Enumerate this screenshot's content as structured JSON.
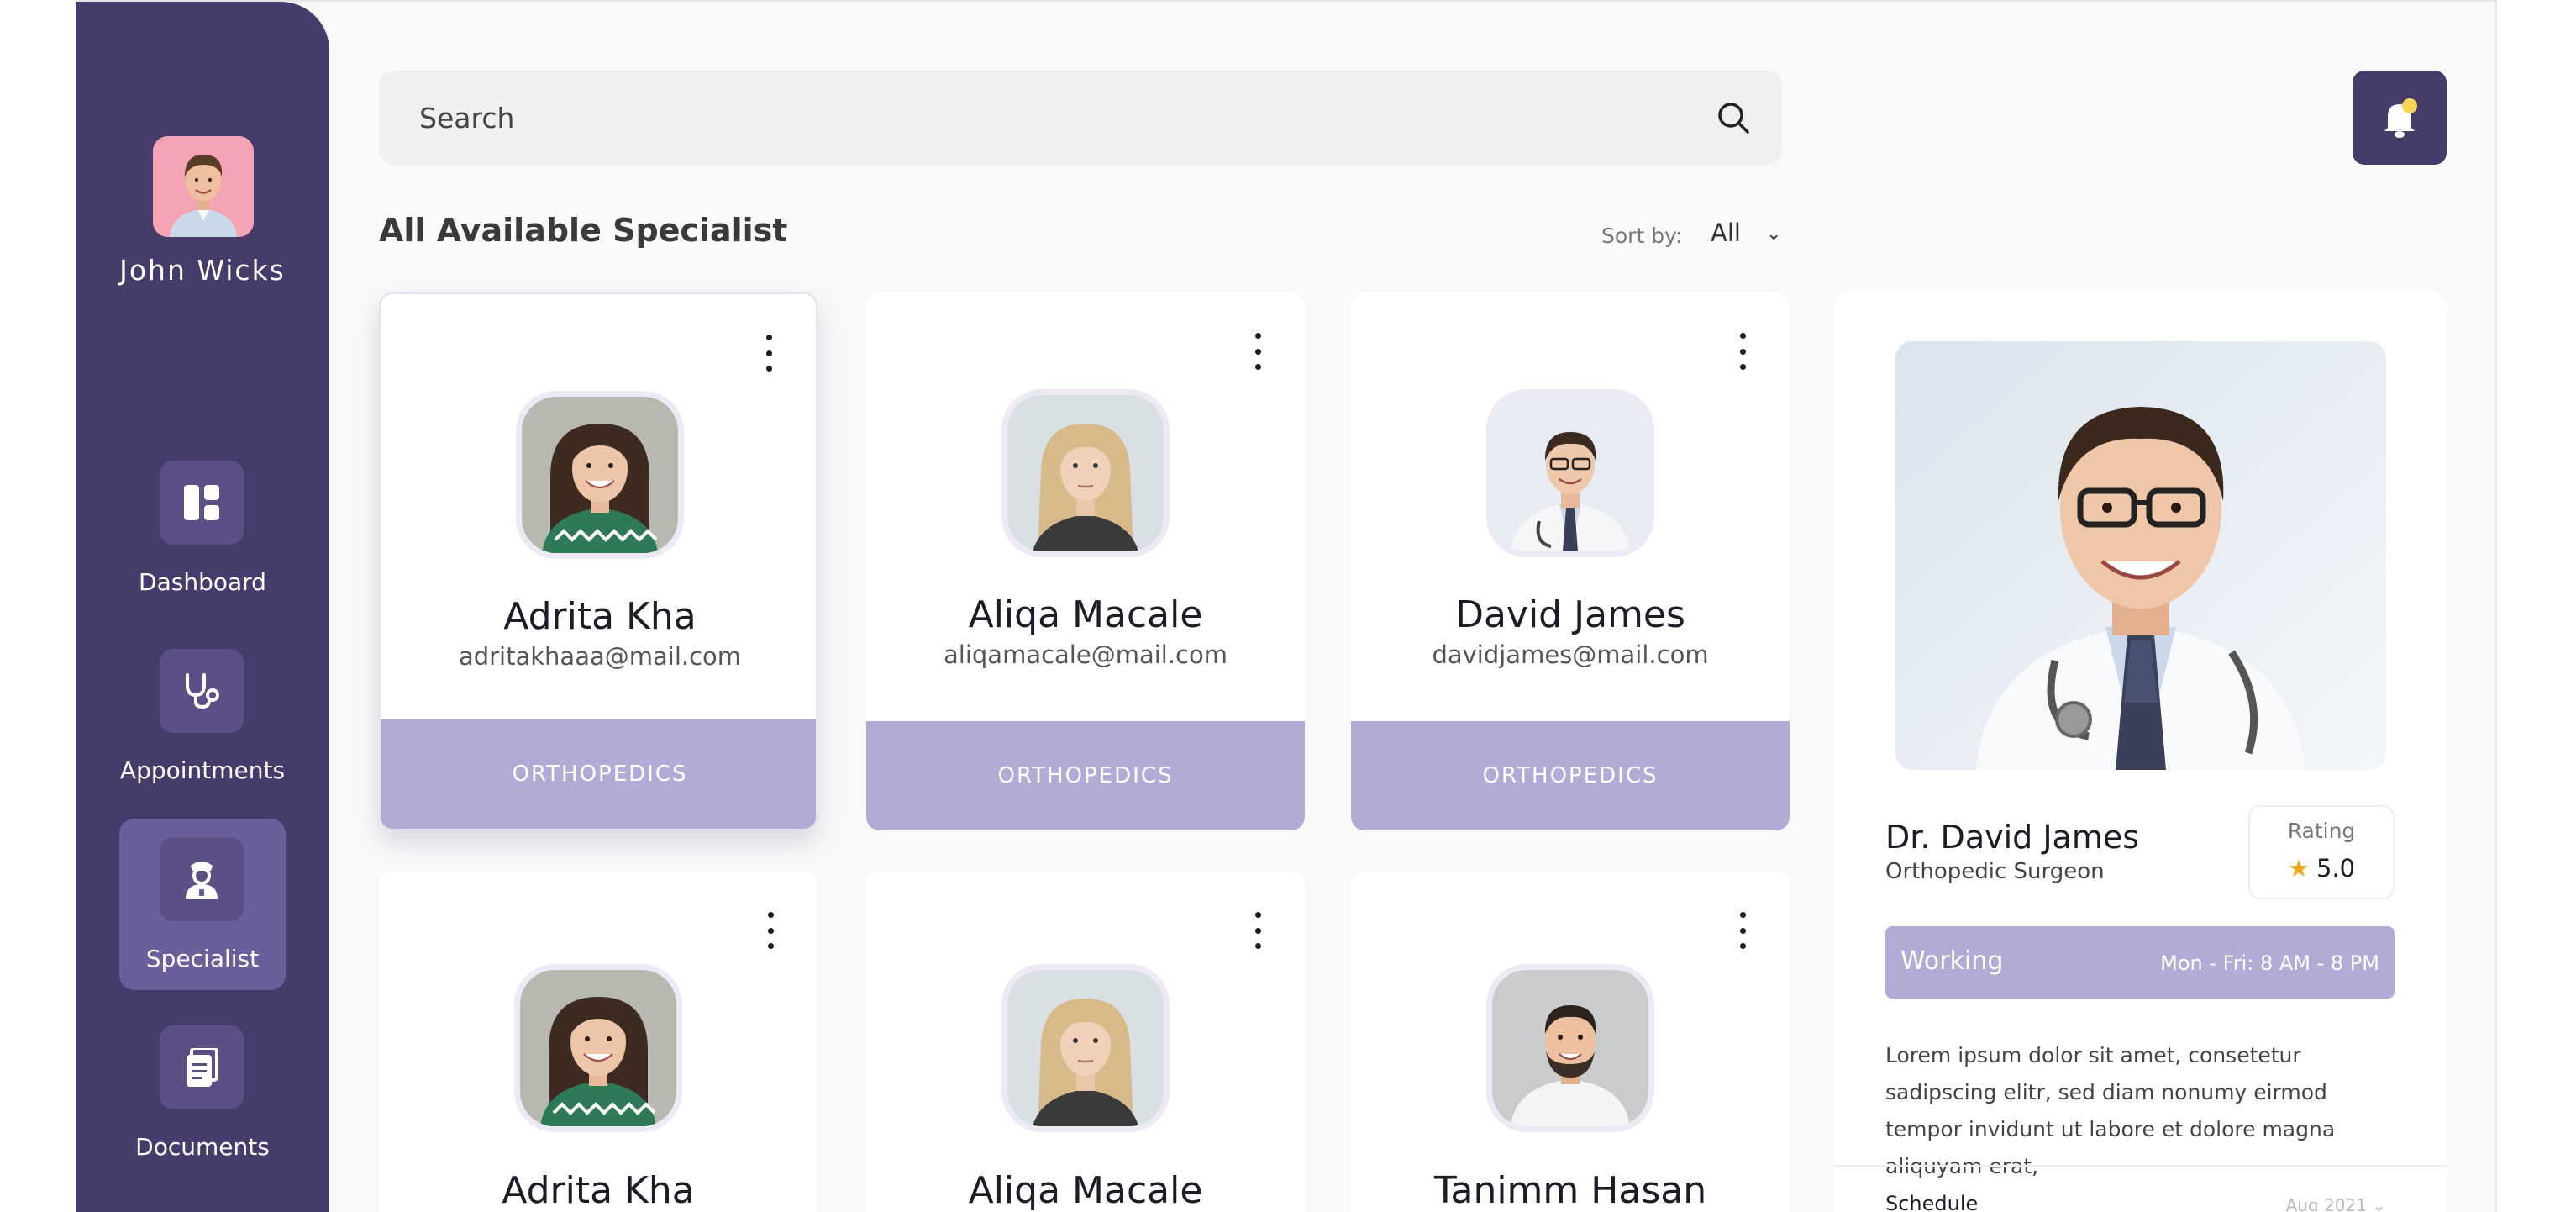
{
  "profile": {
    "name": "John Wicks"
  },
  "nav": [
    {
      "label": "Dashboard",
      "icon": "dashboard-icon",
      "active": false
    },
    {
      "label": "Appointments",
      "icon": "stethoscope-icon",
      "active": false
    },
    {
      "label": "Specialist",
      "icon": "doctor-icon",
      "active": true
    },
    {
      "label": "Documents",
      "icon": "documents-icon",
      "active": false
    }
  ],
  "search": {
    "placeholder": "Search"
  },
  "list": {
    "title": "All Available Specialist",
    "sort_label": "Sort by:",
    "sort_value": "All"
  },
  "cards": [
    {
      "name": "Adrita Kha",
      "email": "adritakhaaa@mail.com",
      "department": "ORTHOPEDICS",
      "selected": true
    },
    {
      "name": "Aliqa Macale",
      "email": "aliqamacale@mail.com",
      "department": "ORTHOPEDICS",
      "selected": false
    },
    {
      "name": "David James",
      "email": "davidjames@mail.com",
      "department": "ORTHOPEDICS",
      "selected": false
    },
    {
      "name": "Adrita Kha",
      "email": "",
      "department": "",
      "selected": false
    },
    {
      "name": "Aliqa Macale",
      "email": "",
      "department": "",
      "selected": false
    },
    {
      "name": "Tanimm Hasan",
      "email": "",
      "department": "",
      "selected": false
    }
  ],
  "detail": {
    "name": "Dr. David James",
    "role": "Orthopedic Surgeon",
    "rating_label": "Rating",
    "rating_value": "5.0",
    "working_label": "Working",
    "working_hours": "Mon - Fri: 8 AM - 8 PM",
    "description": "Lorem ipsum dolor sit amet, consetetur sadipscing elitr, sed diam nonumy eirmod tempor invidunt ut labore et dolore magna aliquyam erat,",
    "schedule_label": "Schedule",
    "schedule_date": "Aug 2021"
  },
  "colors": {
    "sidebar": "#463c6b",
    "accent": "#b1abd6",
    "star": "#f6a71f",
    "notification_dot": "#f7d65a"
  }
}
